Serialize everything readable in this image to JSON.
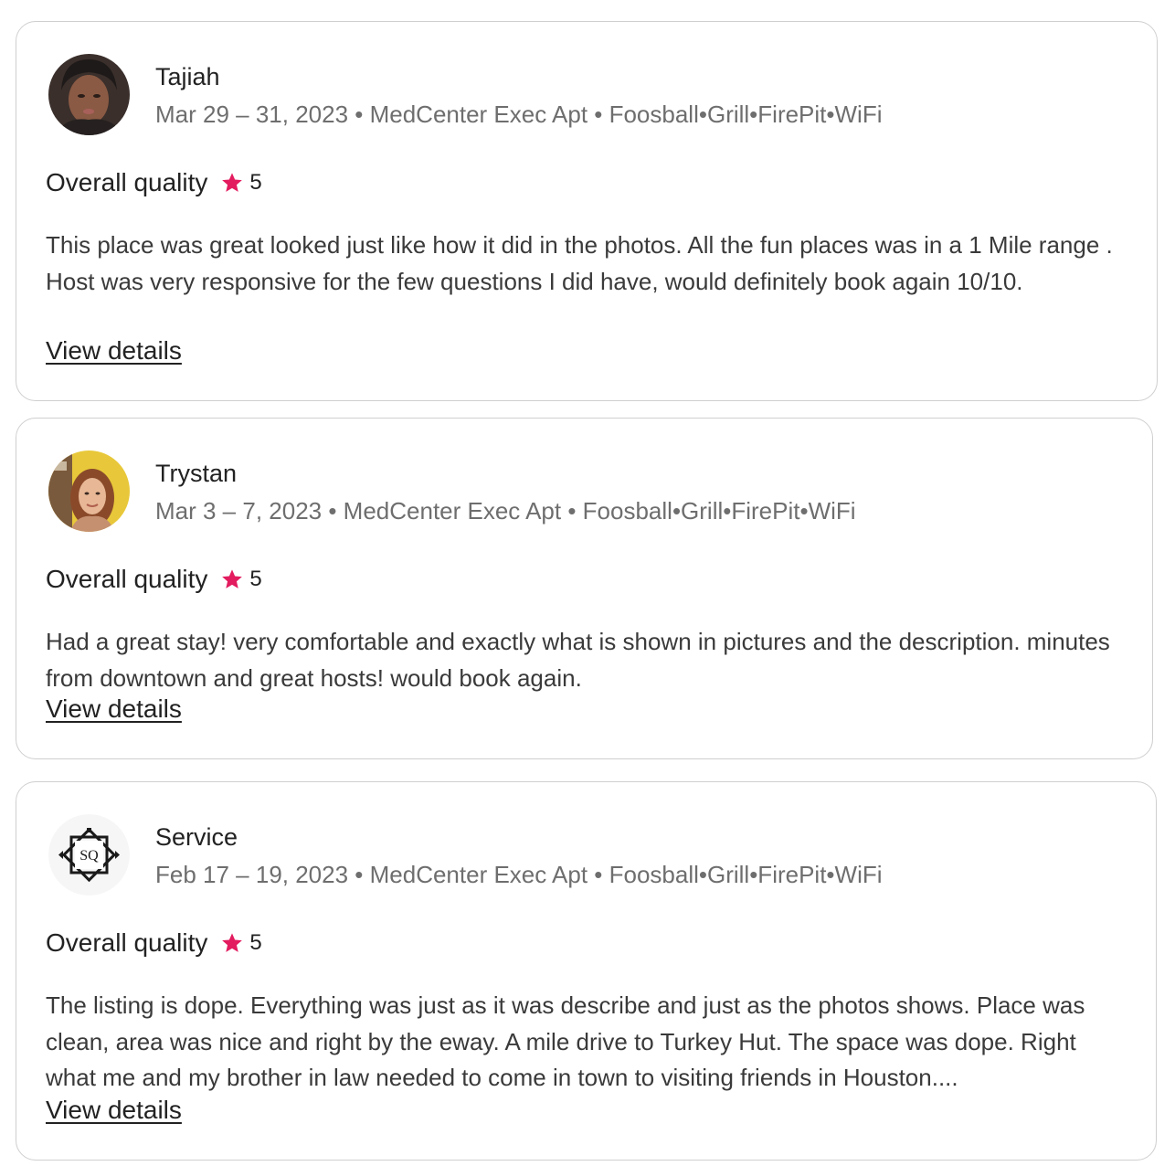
{
  "reviews": [
    {
      "name": "Tajiah",
      "meta": "Mar 29 – 31, 2023 • MedCenter Exec Apt • Foosball•Grill•FirePit•WiFi",
      "rating_label": "Overall quality",
      "rating_value": "5",
      "text": "This place was great looked just like how it did in the photos. All the fun places was in a 1 Mile range . Host was very responsive for the few questions I did have, would definitely book again 10/10.",
      "link": "View details"
    },
    {
      "name": "Trystan",
      "meta": "Mar 3 – 7, 2023 • MedCenter Exec Apt • Foosball•Grill•FirePit•WiFi",
      "rating_label": "Overall quality",
      "rating_value": "5",
      "text": "Had a great stay! very comfortable and exactly what is shown in pictures and the description. minutes from downtown and great hosts! would book again.",
      "link": "View details"
    },
    {
      "name": "Service",
      "meta": "Feb 17 – 19, 2023 • MedCenter Exec Apt • Foosball•Grill•FirePit•WiFi",
      "rating_label": "Overall quality",
      "rating_value": "5",
      "avatar_logo_text": "SQ",
      "text": "The listing is dope. Everything was just as it was describe and just as the photos shows. Place was clean, area was nice and right by the eway. A mile drive to Turkey Hut. The space was dope. Right what me and my brother in law needed to come in town to visiting friends in Houston....",
      "link": "View details"
    }
  ],
  "icons": {
    "star": "star-icon"
  },
  "colors": {
    "star": "#E31C5F",
    "border": "#CFCFCF",
    "meta_text": "#6E6E6E"
  }
}
